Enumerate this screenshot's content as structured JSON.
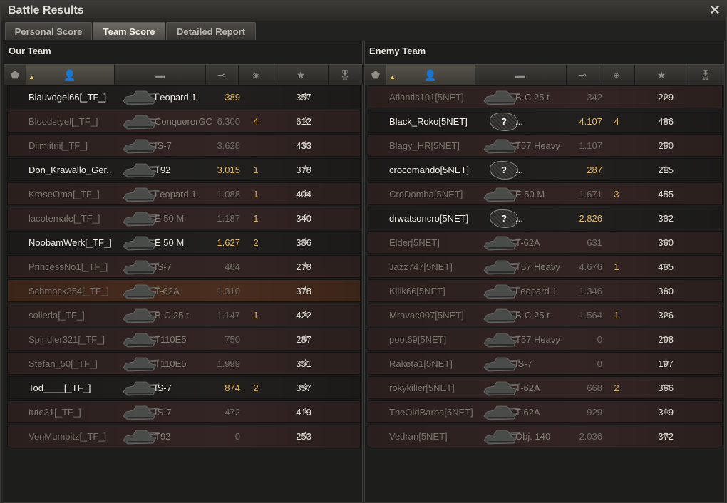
{
  "window": {
    "title": "Battle Results"
  },
  "tabs": [
    {
      "label": "Personal Score",
      "active": false
    },
    {
      "label": "Team Score",
      "active": true
    },
    {
      "label": "Detailed Report",
      "active": false
    }
  ],
  "columns": [
    {
      "icon": "badge-icon"
    },
    {
      "icon": "player-icon",
      "sorted": true
    },
    {
      "icon": "tank-icon"
    },
    {
      "icon": "damage-icon"
    },
    {
      "icon": "kills-icon"
    },
    {
      "icon": "experience-star-icon"
    },
    {
      "icon": "medal-icon"
    }
  ],
  "our_team": {
    "title": "Our Team",
    "players": [
      {
        "name": "Blauvogel66[_TF_]",
        "tank": "Leopard 1",
        "damage": "389",
        "kills": "",
        "xp": "357",
        "alive": true,
        "gold": true
      },
      {
        "name": "Bloodstyel[_TF_]",
        "tank": "ConquerorGC",
        "damage": "6.300",
        "kills": "4",
        "xp": "612",
        "alive": false,
        "gold": false
      },
      {
        "name": "Diimiitrii[_TF_]",
        "tank": "IS-7",
        "damage": "3.628",
        "kills": "",
        "xp": "433",
        "alive": false,
        "gold": false
      },
      {
        "name": "Don_Krawallo_Ger..",
        "tank": "T92",
        "damage": "3.015",
        "kills": "1",
        "xp": "378",
        "alive": true,
        "gold": true
      },
      {
        "name": "KraseOma[_TF_]",
        "tank": "Leopard 1",
        "damage": "1.088",
        "kills": "1",
        "xp": "404",
        "alive": false,
        "gold": false
      },
      {
        "name": "lacotemale[_TF_]",
        "tank": "E 50 M",
        "damage": "1.187",
        "kills": "1",
        "xp": "340",
        "alive": false,
        "gold": false
      },
      {
        "name": "NoobamWerk[_TF_]",
        "tank": "E 50 M",
        "damage": "1.627",
        "kills": "2",
        "xp": "386",
        "alive": true,
        "gold": true
      },
      {
        "name": "PrincessNo1[_TF_]",
        "tank": "IS-7",
        "damage": "464",
        "kills": "",
        "xp": "278",
        "alive": false,
        "gold": false
      },
      {
        "name": "Schmock354[_TF_]",
        "tank": "T-62A",
        "damage": "1.310",
        "kills": "",
        "xp": "378",
        "alive": false,
        "gold": false,
        "highlight": true
      },
      {
        "name": "solleda[_TF_]",
        "tank": "B-C 25 t",
        "damage": "1.147",
        "kills": "1",
        "xp": "422",
        "alive": false,
        "gold": false
      },
      {
        "name": "Spindler321[_TF_]",
        "tank": "T110E5",
        "damage": "750",
        "kills": "",
        "xp": "287",
        "alive": false,
        "gold": false
      },
      {
        "name": "Stefan_50[_TF_]",
        "tank": "T110E5",
        "damage": "1.999",
        "kills": "",
        "xp": "351",
        "alive": false,
        "gold": false
      },
      {
        "name": "Tod____[_TF_]",
        "tank": "IS-7",
        "damage": "874",
        "kills": "2",
        "xp": "357",
        "alive": true,
        "gold": true
      },
      {
        "name": "tute31[_TF_]",
        "tank": "IS-7",
        "damage": "472",
        "kills": "",
        "xp": "419",
        "alive": false,
        "gold": false
      },
      {
        "name": "VonMumpitz[_TF_]",
        "tank": "T92",
        "damage": "0",
        "kills": "",
        "xp": "253",
        "alive": false,
        "gold": false
      }
    ]
  },
  "enemy_team": {
    "title": "Enemy Team",
    "players": [
      {
        "name": "Atlantis101[5NET]",
        "tank": "B-C 25 t",
        "damage": "342",
        "kills": "",
        "xp": "229",
        "alive": false,
        "gold": false
      },
      {
        "name": "Black_Roko[5NET]",
        "tank": "...",
        "damage": "4.107",
        "kills": "4",
        "xp": "486",
        "alive": true,
        "gold": true,
        "unknown": true
      },
      {
        "name": "Blagy_HR[5NET]",
        "tank": "T57 Heavy",
        "damage": "1.107",
        "kills": "",
        "xp": "250",
        "alive": false,
        "gold": false
      },
      {
        "name": "crocomando[5NET]",
        "tank": "...",
        "damage": "287",
        "kills": "",
        "xp": "215",
        "alive": true,
        "gold": true,
        "unknown": true
      },
      {
        "name": "CroDomba[5NET]",
        "tank": "E 50 M",
        "damage": "1.671",
        "kills": "3",
        "xp": "455",
        "alive": false,
        "gold": false
      },
      {
        "name": "drwatsoncro[5NET]",
        "tank": "...",
        "damage": "2.826",
        "kills": "",
        "xp": "332",
        "alive": true,
        "gold": true,
        "unknown": true
      },
      {
        "name": "Elder[5NET]",
        "tank": "T-62A",
        "damage": "631",
        "kills": "",
        "xp": "360",
        "alive": false,
        "gold": false
      },
      {
        "name": "Jazz747[5NET]",
        "tank": "T57 Heavy",
        "damage": "4.676",
        "kills": "1",
        "xp": "455",
        "alive": false,
        "gold": false
      },
      {
        "name": "Kilik66[5NET]",
        "tank": "Leopard 1",
        "damage": "1.346",
        "kills": "",
        "xp": "360",
        "alive": false,
        "gold": false
      },
      {
        "name": "Mravac007[5NET]",
        "tank": "B-C 25 t",
        "damage": "1.564",
        "kills": "1",
        "xp": "326",
        "alive": false,
        "gold": false
      },
      {
        "name": "poot69[5NET]",
        "tank": "T57 Heavy",
        "damage": "0",
        "kills": "",
        "xp": "208",
        "alive": false,
        "gold": false
      },
      {
        "name": "Raketa1[5NET]",
        "tank": "IS-7",
        "damage": "0",
        "kills": "",
        "xp": "197",
        "alive": false,
        "gold": false
      },
      {
        "name": "rokykiller[5NET]",
        "tank": "T-62A",
        "damage": "668",
        "kills": "2",
        "xp": "366",
        "alive": false,
        "gold": false
      },
      {
        "name": "TheOldBarba[5NET]",
        "tank": "T-62A",
        "damage": "929",
        "kills": "",
        "xp": "319",
        "alive": false,
        "gold": false
      },
      {
        "name": "Vedran[5NET]",
        "tank": "Obj. 140",
        "damage": "2.036",
        "kills": "",
        "xp": "372",
        "alive": false,
        "gold": false
      }
    ]
  },
  "colors": {
    "gold_text": "#e2b866",
    "dead_row": "#2f2321",
    "alive_row": "#1f1e1c",
    "highlight_row": "#4a2e1f"
  }
}
